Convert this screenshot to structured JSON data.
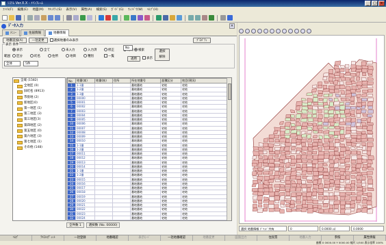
{
  "window": {
    "title": "ｼｽﾃﾑ Ver.X.X - ﾒｲﾝﾌﾚｰﾑ",
    "min": "_",
    "max": "□",
    "close": "×"
  },
  "menu": [
    "ﾌｧｲﾙ(F)",
    "編集(E)",
    "地図(M)",
    "ｾｷｭﾘﾃｨ(S)",
    "表示(V)",
    "属性(A)",
    "検索(S)",
    "ｶﾞｲﾄﾞ(G)",
    "ｳｨﾝﾄﾞｳ(W)",
    "ﾍﾙﾌﾟ(H)"
  ],
  "panel": {
    "title": "ﾃﾞｰﾀ入力",
    "tabs": [
      "ﾒﾆｭｰ",
      "住居情報",
      "地番情報"
    ],
    "buttons": {
      "b1": "地番追加(A)",
      "b2": "一括変更",
      "b3": "選択地番のみ表示",
      "b4": "ﾌﾟﾛﾊﾟﾃｨ"
    },
    "group_title": "表示 条件",
    "opt": {
      "r1": "表示",
      "r2": "全て",
      "r3": "未入力",
      "r4": "入力済",
      "r5": "修正",
      "r6": "削除"
    },
    "row2": {
      "l1": "範囲",
      "l2": "区分",
      "l3": "町名",
      "l4": "住所",
      "l5": "地目",
      "l6": "種別",
      "c1": "一覧"
    },
    "sel1": "全体",
    "sel2": "5件",
    "sel3": "No",
    "btn_search": "検索",
    "btn_apply": "適用",
    "chk_disp": "表示",
    "btn_clear": "選択解除"
  },
  "tree": [
    {
      "label": "全域 (1582)"
    },
    {
      "label": "全地区 (0)"
    },
    {
      "label": "旧町名 (8913)"
    },
    {
      "label": "市街地 (2)"
    },
    {
      "label": "新地区(0)"
    },
    {
      "label": "第一地区 (1)"
    },
    {
      "label": "第二地区 (3)"
    },
    {
      "label": "第三地区(3)"
    },
    {
      "label": "第四地区 (2)"
    },
    {
      "label": "第五地区 (0)"
    },
    {
      "label": "第六地区 (3)"
    },
    {
      "label": "第七地区 (1)"
    },
    {
      "label": "その他 (148)"
    }
  ],
  "grid": {
    "headers": [
      "No",
      "地番(本)",
      "地番(枝)",
      "住所",
      "所在地番号",
      "面積区分",
      "地目(現況)"
    ],
    "rows": [
      [
        "1",
        "1-1番",
        "",
        "",
        "番地番地",
        "宅地",
        "宅地"
      ],
      [
        "2",
        "1-2番",
        "",
        "",
        "番地番地",
        "宅地",
        "宅地"
      ],
      [
        "3",
        "1-3番",
        "",
        "",
        "番地番地",
        "宅地",
        "宅地"
      ],
      [
        "4",
        "00000",
        "",
        "",
        "番地番地",
        "宅地",
        "宅地"
      ],
      [
        "5",
        "00001",
        "",
        "",
        "番地番地",
        "宅地",
        "宅地"
      ],
      [
        "6",
        "00002",
        "",
        "",
        "番地番地",
        "宅地",
        "宅地"
      ],
      [
        "7",
        "00003",
        "",
        "",
        "番地番地",
        "宅地",
        "宅地"
      ],
      [
        "8",
        "00004",
        "",
        "",
        "番地番地",
        "宅地",
        "宅地"
      ],
      [
        "9",
        "00005",
        "",
        "",
        "番地番地",
        "宅地",
        "宅地"
      ],
      [
        "10",
        "00006",
        "",
        "",
        "番地番地",
        "宅地",
        "宅地"
      ],
      [
        "11",
        "00007",
        "",
        "",
        "番地番地",
        "宅地",
        "宅地"
      ],
      [
        "12",
        "00008",
        "",
        "",
        "番地番地",
        "宅地",
        "宅地"
      ],
      [
        "13",
        "00009",
        "",
        "",
        "番地番地",
        "宅地",
        "宅地"
      ],
      [
        "14",
        "00010",
        "",
        "",
        "番地番地",
        "宅地",
        "宅地"
      ],
      [
        "15",
        "1-1番",
        "",
        "",
        "番地番地",
        "宅地",
        "宅地"
      ],
      [
        "16",
        "1-2番",
        "",
        "",
        "番地番地",
        "宅地",
        "宅地"
      ],
      [
        "17",
        "00011",
        "",
        "",
        "番地番地",
        "宅地",
        "宅地"
      ],
      [
        "18",
        "00012",
        "",
        "",
        "番地番地",
        "宅地",
        "宅地"
      ],
      [
        "19",
        "00013",
        "",
        "",
        "番地番地",
        "宅地",
        "宅地"
      ],
      [
        "20",
        "00014",
        "",
        "",
        "番地番地",
        "宅地",
        "宅地"
      ],
      [
        "21",
        "1-1番",
        "",
        "",
        "番地番地",
        "宅地",
        "宅地"
      ],
      [
        "22",
        "1-2番",
        "",
        "",
        "番地番地",
        "宅地",
        "宅地"
      ],
      [
        "23",
        "00015",
        "",
        "",
        "番地番地",
        "宅地",
        "宅地"
      ],
      [
        "24",
        "00016",
        "",
        "",
        "番地番地",
        "宅地",
        "宅地"
      ],
      [
        "25",
        "00017",
        "",
        "",
        "番地番地",
        "宅地",
        "宅地"
      ],
      [
        "26",
        "00018",
        "",
        "",
        "番地番地",
        "宅地",
        "宅地"
      ],
      [
        "27",
        "00019",
        "",
        "",
        "番地番地",
        "宅地",
        "宅地"
      ],
      [
        "28",
        "00020",
        "",
        "",
        "番地番地",
        "宅地",
        "宅地"
      ],
      [
        "29",
        "00021",
        "",
        "",
        "番地番地",
        "宅地",
        "宅地"
      ],
      [
        "30",
        "00022",
        "",
        "",
        "番地番地",
        "宅地",
        "宅地"
      ],
      [
        "31",
        "00023",
        "",
        "",
        "番地番地",
        "宅地",
        "宅地"
      ],
      [
        "32",
        "00024",
        "",
        "",
        "番地番地",
        "宅地",
        "宅地"
      ],
      [
        "33",
        "00025",
        "",
        "",
        "番地番地",
        "宅地",
        "宅地"
      ],
      [
        "34",
        "00026",
        "",
        "",
        "番地番地",
        "宅地",
        "宅地"
      ],
      [
        "35",
        "00027",
        "",
        "",
        "番地番地",
        "宅地",
        "宅地"
      ],
      [
        "36",
        "00028",
        "",
        "",
        "番地番地",
        "宅地",
        "宅地"
      ]
    ]
  },
  "grid_status": {
    "s1": "全件数 1",
    "s2": "選択数 (No. 00000)"
  },
  "map_status": {
    "s1": "選択 地番情報 ｸﾞﾘｯﾄﾞ共有",
    "s2": "0",
    "s3": "0.0000 ㎡",
    "s4": "0.0000"
  },
  "footer": [
    "ﾍﾙﾌﾟ",
    "ﾃｷｽﾄｴﾃﾞｨｯﾄ",
    "一括登録",
    "地番確認",
    "表示ﾓｰﾄﾞ",
    "一括地番確認",
    "地番変更",
    "図面出力",
    "住民票",
    "地番入力",
    "参照",
    "属性情報"
  ],
  "footer_dim": [
    false,
    false,
    false,
    false,
    true,
    false,
    true,
    true,
    false,
    true,
    false,
    false
  ],
  "statusbar": "座標 X 0000.00  Y 0000.00  縮尺 1/500  表示倍率 100%",
  "colors": {
    "accent": "#0a246a",
    "rownum": "#3b66c8",
    "parcel_red": "#e8b4b0",
    "parcel_green": "#d8ecc8",
    "parcel_purple": "#cfc4dc"
  }
}
